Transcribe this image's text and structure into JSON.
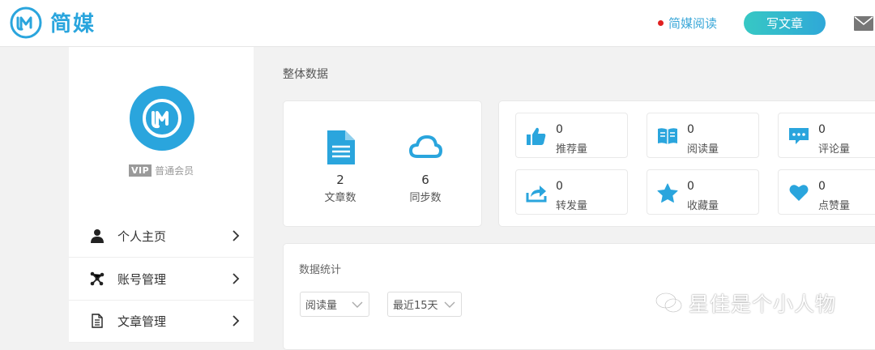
{
  "header": {
    "brand": "简媒",
    "reader_link": "简媒阅读",
    "write_button": "写文章"
  },
  "profile": {
    "vip_badge": "VIP",
    "member_level": "普通会员"
  },
  "sidebar": {
    "items": [
      {
        "label": "个人主页",
        "icon": "user-icon"
      },
      {
        "label": "账号管理",
        "icon": "network-icon"
      },
      {
        "label": "文章管理",
        "icon": "document-icon"
      }
    ]
  },
  "overview": {
    "title": "整体数据",
    "articles": {
      "value": "2",
      "label": "文章数"
    },
    "syncs": {
      "value": "6",
      "label": "同步数"
    },
    "metrics": [
      {
        "value": "0",
        "label": "推荐量",
        "icon": "thumbs-up-icon"
      },
      {
        "value": "0",
        "label": "阅读量",
        "icon": "open-book-icon"
      },
      {
        "value": "0",
        "label": "评论量",
        "icon": "comment-icon"
      },
      {
        "value": "0",
        "label": "转发量",
        "icon": "share-icon"
      },
      {
        "value": "0",
        "label": "收藏量",
        "icon": "star-icon"
      },
      {
        "value": "0",
        "label": "点赞量",
        "icon": "heart-icon"
      }
    ]
  },
  "stats": {
    "title": "数据统计",
    "metric_select": "阅读量",
    "range_select": "最近15天"
  },
  "watermark": "星佳是个小人物",
  "colors": {
    "accent": "#2aa5dd",
    "button_start": "#37c8c4",
    "button_end": "#2fa8d8"
  }
}
